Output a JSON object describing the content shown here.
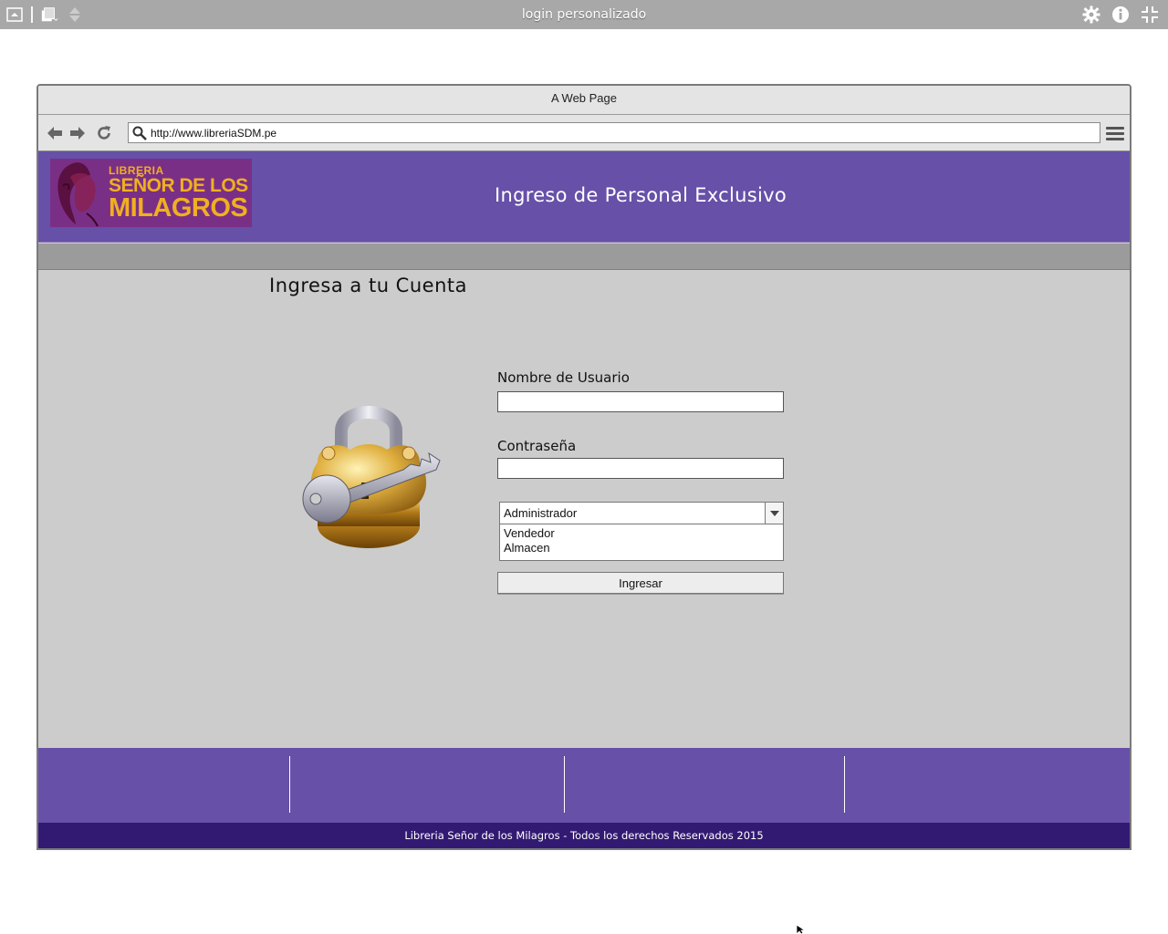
{
  "app": {
    "title": "login personalizado"
  },
  "browser": {
    "window_title": "A Web Page",
    "url": "http://www.libreriaSDM.pe"
  },
  "header": {
    "logo_line1": "LIBRERIA",
    "logo_line2": "SEÑOR DE LOS",
    "logo_line3": "MILAGROS",
    "title": "Ingreso de Personal Exclusivo"
  },
  "login": {
    "heading": "Ingresa a tu Cuenta",
    "username_label": "Nombre de Usuario",
    "username_value": "",
    "password_label": "Contraseña",
    "password_value": "",
    "role_selected": "Administrador",
    "role_options": [
      "Vendedor",
      "Almacen"
    ],
    "submit_label": "Ingresar"
  },
  "footer": {
    "copyright": "Libreria Señor de los Milagros - Todos los derechos Reservados 2015"
  },
  "colors": {
    "header_bg": "#6750a8",
    "footer_bottom_bg": "#321a72",
    "logo_bg": "#7a2f86",
    "logo_text": "#f0b020",
    "content_bg": "#cccccc"
  }
}
